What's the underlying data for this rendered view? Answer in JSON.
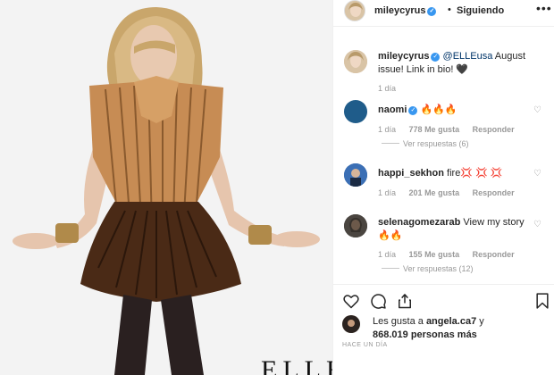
{
  "header": {
    "username": "mileycyrus",
    "separator": "•",
    "follow_status": "Siguiendo",
    "more": "•••"
  },
  "photo": {
    "logo_text": "ELLE"
  },
  "caption": {
    "username": "mileycyrus",
    "mention": "@ELLEusa",
    "text": " August issue! Link in bio! 🖤",
    "time": "1 día"
  },
  "comments": [
    {
      "username": "naomi",
      "text": " 🔥🔥🔥",
      "time": "1 día",
      "likes": "778 Me gusta",
      "reply": "Responder",
      "view_replies": "Ver respuestas (6)",
      "avatar_color": "#1f5c8a"
    },
    {
      "username": "happi_sekhon",
      "text": " fire💢 💢 💢",
      "time": "1 día",
      "likes": "201 Me gusta",
      "reply": "Responder",
      "avatar_color": "#2a5a9e"
    },
    {
      "username": "selenagomezarab",
      "text": " View my story 🔥🔥",
      "time": "1 día",
      "likes": "155 Me gusta",
      "reply": "Responder",
      "view_replies": "Ver respuestas (12)",
      "avatar_color": "#3a3a3a"
    }
  ],
  "actions": {
    "likes_prefix": "Les gusta a ",
    "likes_user": "angela.ca7",
    "likes_suffix": " y",
    "likes_count": "868.019 personas más",
    "time_ago": "HACE UN DÍA"
  },
  "colors": {
    "verified": "#3897f0",
    "border": "#efefef",
    "meta_text": "#999999"
  }
}
